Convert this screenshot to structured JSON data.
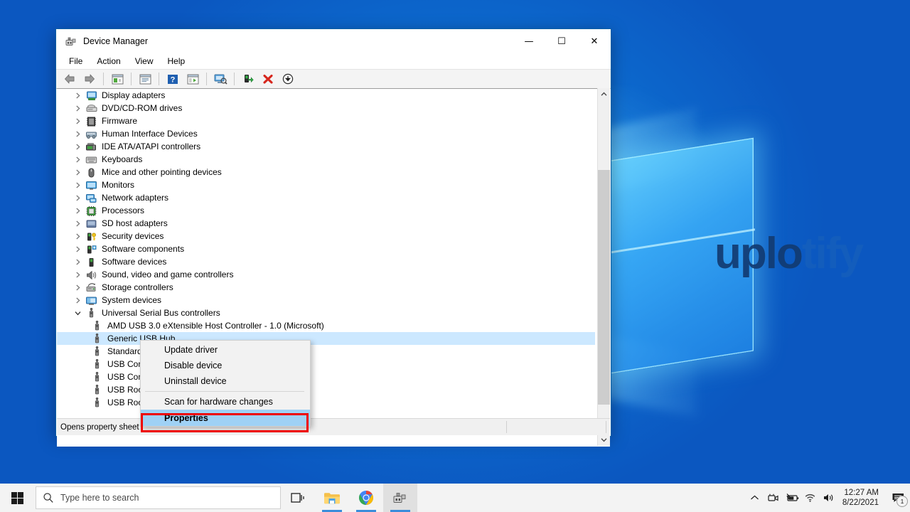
{
  "desktop": {
    "watermark_primary": "uplo",
    "watermark_secondary": "tify"
  },
  "window": {
    "title": "Device Manager",
    "icon": "device-manager-icon",
    "controls": {
      "minimize": "—",
      "maximize": "☐",
      "close": "✕"
    },
    "menus": [
      {
        "label": "File",
        "name": "menu-file"
      },
      {
        "label": "Action",
        "name": "menu-action"
      },
      {
        "label": "View",
        "name": "menu-view"
      },
      {
        "label": "Help",
        "name": "menu-help"
      }
    ],
    "toolbar": [
      {
        "name": "back-button",
        "icon": "back-arrow-icon"
      },
      {
        "name": "forward-button",
        "icon": "forward-arrow-icon"
      },
      {
        "name": "separator-1",
        "icon": "separator"
      },
      {
        "name": "show-hide-console-tree-button",
        "icon": "console-tree-icon"
      },
      {
        "name": "separator-2",
        "icon": "separator"
      },
      {
        "name": "properties-button",
        "icon": "properties-icon"
      },
      {
        "name": "separator-3",
        "icon": "separator"
      },
      {
        "name": "help-button",
        "icon": "help-icon"
      },
      {
        "name": "action-button",
        "icon": "action-panel-icon"
      },
      {
        "name": "separator-4",
        "icon": "separator"
      },
      {
        "name": "scan-hardware-changes-button",
        "icon": "scan-monitor-icon"
      },
      {
        "name": "separator-5",
        "icon": "separator"
      },
      {
        "name": "update-driver-button",
        "icon": "update-driver-icon"
      },
      {
        "name": "uninstall-device-button",
        "icon": "red-x-icon"
      },
      {
        "name": "disable-device-button",
        "icon": "down-arrow-circle-icon"
      }
    ],
    "status": {
      "message": "Opens property sheet"
    }
  },
  "tree": {
    "items": [
      {
        "label": "Display adapters",
        "icon": "display-adapter-icon",
        "level": 0,
        "expanded": false,
        "selected": false
      },
      {
        "label": "DVD/CD-ROM drives",
        "icon": "dvd-drive-icon",
        "level": 0,
        "expanded": false,
        "selected": false
      },
      {
        "label": "Firmware",
        "icon": "firmware-chip-icon",
        "level": 0,
        "expanded": false,
        "selected": false
      },
      {
        "label": "Human Interface Devices",
        "icon": "hid-icon",
        "level": 0,
        "expanded": false,
        "selected": false
      },
      {
        "label": "IDE ATA/ATAPI controllers",
        "icon": "ide-controller-icon",
        "level": 0,
        "expanded": false,
        "selected": false
      },
      {
        "label": "Keyboards",
        "icon": "keyboard-icon",
        "level": 0,
        "expanded": false,
        "selected": false
      },
      {
        "label": "Mice and other pointing devices",
        "icon": "mouse-icon",
        "level": 0,
        "expanded": false,
        "selected": false
      },
      {
        "label": "Monitors",
        "icon": "monitor-icon",
        "level": 0,
        "expanded": false,
        "selected": false
      },
      {
        "label": "Network adapters",
        "icon": "network-adapter-icon",
        "level": 0,
        "expanded": false,
        "selected": false
      },
      {
        "label": "Processors",
        "icon": "processor-icon",
        "level": 0,
        "expanded": false,
        "selected": false
      },
      {
        "label": "SD host adapters",
        "icon": "sd-adapter-icon",
        "level": 0,
        "expanded": false,
        "selected": false
      },
      {
        "label": "Security devices",
        "icon": "security-key-icon",
        "level": 0,
        "expanded": false,
        "selected": false
      },
      {
        "label": "Software components",
        "icon": "software-component-icon",
        "level": 0,
        "expanded": false,
        "selected": false
      },
      {
        "label": "Software devices",
        "icon": "software-device-icon",
        "level": 0,
        "expanded": false,
        "selected": false
      },
      {
        "label": "Sound, video and game controllers",
        "icon": "speaker-icon",
        "level": 0,
        "expanded": false,
        "selected": false
      },
      {
        "label": "Storage controllers",
        "icon": "storage-controller-icon",
        "level": 0,
        "expanded": false,
        "selected": false
      },
      {
        "label": "System devices",
        "icon": "system-device-icon",
        "level": 0,
        "expanded": false,
        "selected": false
      },
      {
        "label": "Universal Serial Bus controllers",
        "icon": "usb-icon",
        "level": 0,
        "expanded": true,
        "selected": false
      },
      {
        "label": "AMD USB 3.0 eXtensible Host Controller - 1.0 (Microsoft)",
        "icon": "usb-icon",
        "level": 1,
        "expanded": null,
        "selected": false
      },
      {
        "label": "Generic USB Hub",
        "icon": "usb-icon",
        "level": 1,
        "expanded": null,
        "selected": true
      },
      {
        "label": "Standard USB Host Controller",
        "icon": "usb-icon",
        "level": 1,
        "expanded": null,
        "selected": false
      },
      {
        "label": "USB Composite Device",
        "icon": "usb-icon",
        "level": 1,
        "expanded": null,
        "selected": false
      },
      {
        "label": "USB Composite Device",
        "icon": "usb-icon",
        "level": 1,
        "expanded": null,
        "selected": false
      },
      {
        "label": "USB Root Hub",
        "icon": "usb-icon",
        "level": 1,
        "expanded": null,
        "selected": false
      },
      {
        "label": "USB Root Hub",
        "icon": "usb-icon",
        "level": 1,
        "expanded": null,
        "selected": false
      }
    ]
  },
  "context_menu": {
    "items": [
      {
        "label": "Update driver",
        "name": "context-update-driver",
        "type": "item"
      },
      {
        "label": "Disable device",
        "name": "context-disable-device",
        "type": "item"
      },
      {
        "label": "Uninstall device",
        "name": "context-uninstall-device",
        "type": "item"
      },
      {
        "label": "",
        "name": "context-separator",
        "type": "separator"
      },
      {
        "label": "Scan for hardware changes",
        "name": "context-scan-hardware",
        "type": "item"
      },
      {
        "label": "Properties",
        "name": "context-properties",
        "type": "highlight"
      }
    ],
    "highlight_color": "#ee0000"
  },
  "taskbar": {
    "start_label": "start-button",
    "search_placeholder": "Type here to search",
    "apps": [
      {
        "name": "taskview-button",
        "icon": "task-view-icon",
        "running": false
      },
      {
        "name": "file-explorer-button",
        "icon": "folder-icon",
        "running": true
      },
      {
        "name": "chrome-button",
        "icon": "chrome-icon",
        "running": true
      },
      {
        "name": "device-manager-button",
        "icon": "device-manager-icon",
        "running": true
      }
    ],
    "tray": [
      {
        "name": "show-hidden-icons-button",
        "icon": "chevron-up-icon"
      },
      {
        "name": "meet-now-button",
        "icon": "camera-icon"
      },
      {
        "name": "battery-button",
        "icon": "battery-icon"
      },
      {
        "name": "network-button",
        "icon": "wifi-icon"
      },
      {
        "name": "volume-button",
        "icon": "speaker-icon"
      }
    ],
    "clock": {
      "time": "12:27 AM",
      "date": "8/22/2021"
    },
    "notifications": {
      "count": "1",
      "icon": "notification-icon"
    }
  }
}
